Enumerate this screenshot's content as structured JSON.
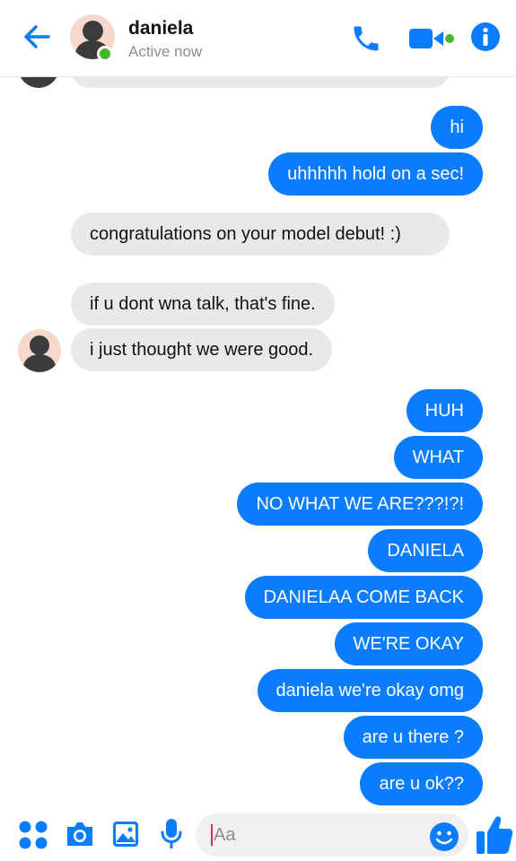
{
  "header": {
    "name": "daniela",
    "status": "Active now"
  },
  "messages_sent_top": [
    "hi",
    "uhhhhh hold on a sec!"
  ],
  "messages_received": [
    "congratulations on your model debut! :)",
    "if u dont wna talk, that's fine.",
    "i just thought we were good."
  ],
  "messages_sent_bottom": [
    "HUH",
    "WHAT",
    "NO WHAT WE ARE???!?!",
    "DANIELA",
    "DANIELAA COME BACK",
    "WE'RE OKAY",
    "daniela we're okay omg",
    "are u there ?",
    "are u ok??"
  ],
  "composer": {
    "placeholder": "Aa"
  },
  "colors": {
    "accent": "#0a7cff",
    "received_bubble": "#e9e9e9",
    "online": "#42b72a"
  },
  "icons": [
    "back-arrow-icon",
    "phone-icon",
    "video-icon",
    "info-icon",
    "menu-dots-icon",
    "camera-icon",
    "image-icon",
    "microphone-icon",
    "emoji-icon",
    "thumbs-up-icon"
  ]
}
